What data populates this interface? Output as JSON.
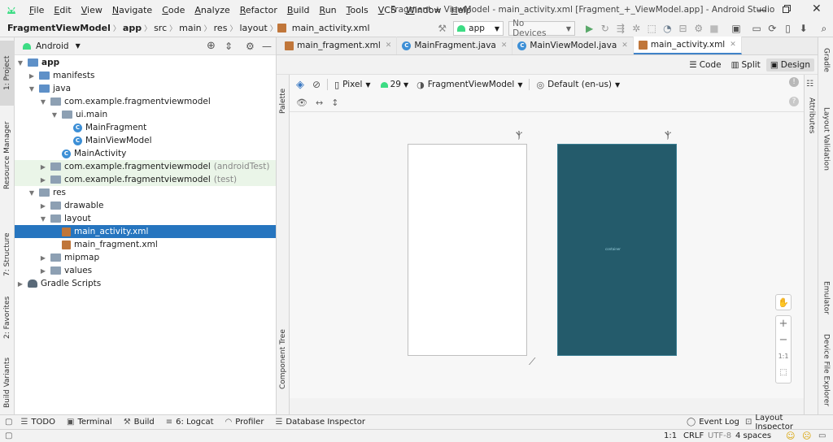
{
  "menu": [
    "File",
    "Edit",
    "View",
    "Navigate",
    "Code",
    "Analyze",
    "Refactor",
    "Build",
    "Run",
    "Tools",
    "VCS",
    "Window",
    "Help"
  ],
  "window_title": "Fragment + ViewModel - main_activity.xml [Fragment_+_ViewModel.app] - Android Studio",
  "breadcrumbs": [
    "FragmentViewModel",
    "app",
    "src",
    "main",
    "res",
    "layout",
    "main_activity.xml"
  ],
  "toolbar": {
    "run_config": "app",
    "device": "No Devices"
  },
  "left_tabs": [
    "1: Project",
    "Resource Manager",
    "7: Structure",
    "2: Favorites",
    "Build Variants"
  ],
  "project_panel": {
    "view_mode": "Android"
  },
  "tree": [
    {
      "label": "app",
      "indent": 0,
      "arrow": "▼",
      "icon": "folder-blue",
      "bold": true
    },
    {
      "label": "manifests",
      "indent": 1,
      "arrow": "▶",
      "icon": "folder-blue"
    },
    {
      "label": "java",
      "indent": 1,
      "arrow": "▼",
      "icon": "folder-blue"
    },
    {
      "label": "com.example.fragmentviewmodel",
      "indent": 2,
      "arrow": "▼",
      "icon": "folder"
    },
    {
      "label": "ui.main",
      "indent": 3,
      "arrow": "▼",
      "icon": "folder"
    },
    {
      "label": "MainFragment",
      "indent": 4,
      "arrow": "",
      "icon": "class"
    },
    {
      "label": "MainViewModel",
      "indent": 4,
      "arrow": "",
      "icon": "class"
    },
    {
      "label": "MainActivity",
      "indent": 3,
      "arrow": "",
      "icon": "class"
    },
    {
      "label": "com.example.fragmentviewmodel",
      "suffix": "(androidTest)",
      "indent": 2,
      "arrow": "▶",
      "icon": "folder",
      "test": true
    },
    {
      "label": "com.example.fragmentviewmodel",
      "suffix": "(test)",
      "indent": 2,
      "arrow": "▶",
      "icon": "folder",
      "test": true
    },
    {
      "label": "res",
      "indent": 1,
      "arrow": "▼",
      "icon": "folder"
    },
    {
      "label": "drawable",
      "indent": 2,
      "arrow": "▶",
      "icon": "folder"
    },
    {
      "label": "layout",
      "indent": 2,
      "arrow": "▼",
      "icon": "folder"
    },
    {
      "label": "main_activity.xml",
      "indent": 3,
      "arrow": "",
      "icon": "xml",
      "selected": true
    },
    {
      "label": "main_fragment.xml",
      "indent": 3,
      "arrow": "",
      "icon": "xml"
    },
    {
      "label": "mipmap",
      "indent": 2,
      "arrow": "▶",
      "icon": "folder"
    },
    {
      "label": "values",
      "indent": 2,
      "arrow": "▶",
      "icon": "folder"
    },
    {
      "label": "Gradle Scripts",
      "indent": 0,
      "arrow": "▶",
      "icon": "gradle"
    }
  ],
  "editor_tabs": [
    {
      "label": "main_fragment.xml",
      "icon": "xml"
    },
    {
      "label": "MainFragment.java",
      "icon": "class"
    },
    {
      "label": "MainViewModel.java",
      "icon": "class"
    },
    {
      "label": "main_activity.xml",
      "icon": "xml",
      "active": true
    }
  ],
  "view_modes": [
    "Code",
    "Split",
    "Design"
  ],
  "design_toolbar": {
    "device": "Pixel",
    "api": "29",
    "theme": "FragmentViewModel",
    "locale": "Default (en-us)"
  },
  "palette_label": "Palette",
  "component_tree_label": "Component Tree",
  "attributes_label": "Attributes",
  "preview_text": "container",
  "zoom_labels": [
    "+",
    "−",
    "1:1"
  ],
  "right_tabs": [
    "Gradle",
    "Layout Validation",
    "Emulator",
    "Device File Explorer"
  ],
  "bottom_tools": [
    "TODO",
    "Terminal",
    "Build",
    "6: Logcat",
    "Profiler",
    "Database Inspector"
  ],
  "bottom_right_tools": [
    "Event Log",
    "Layout Inspector"
  ],
  "status": {
    "position": "1:1",
    "line_sep": "CRLF",
    "encoding": "UTF-8",
    "indent": "4 spaces"
  },
  "colors": {
    "selection": "#2675bf",
    "blueprint": "#245b6b",
    "accent": "#4083c9"
  }
}
